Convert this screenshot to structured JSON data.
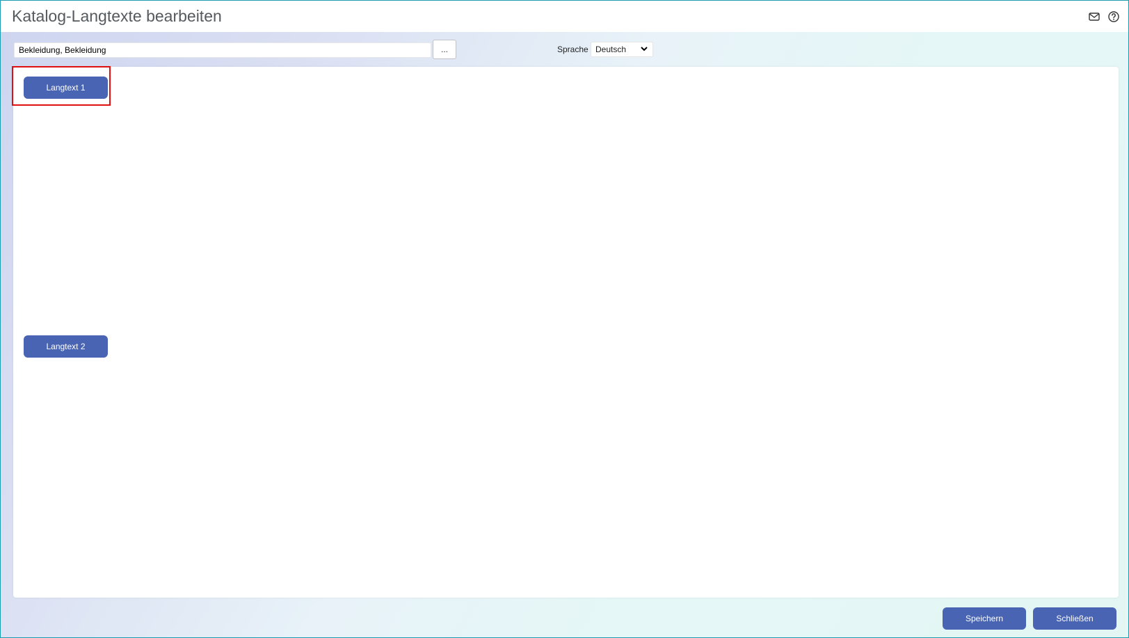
{
  "window": {
    "title": "Katalog-Langtexte bearbeiten",
    "icons": [
      "mail-icon",
      "help-icon"
    ]
  },
  "toolbar": {
    "catalog_value": "Bekleidung, Bekleidung",
    "browse_label": "...",
    "language_label": "Sprache",
    "language_value": "Deutsch"
  },
  "main": {
    "langtext_buttons": [
      {
        "label": "Langtext 1",
        "highlighted": true
      },
      {
        "label": "Langtext 2",
        "highlighted": false
      }
    ]
  },
  "footer": {
    "save_label": "Speichern",
    "close_label": "Schließen"
  },
  "colors": {
    "accent": "#4a64b4",
    "window_border": "#1a9bb0",
    "highlight": "#e01010"
  }
}
